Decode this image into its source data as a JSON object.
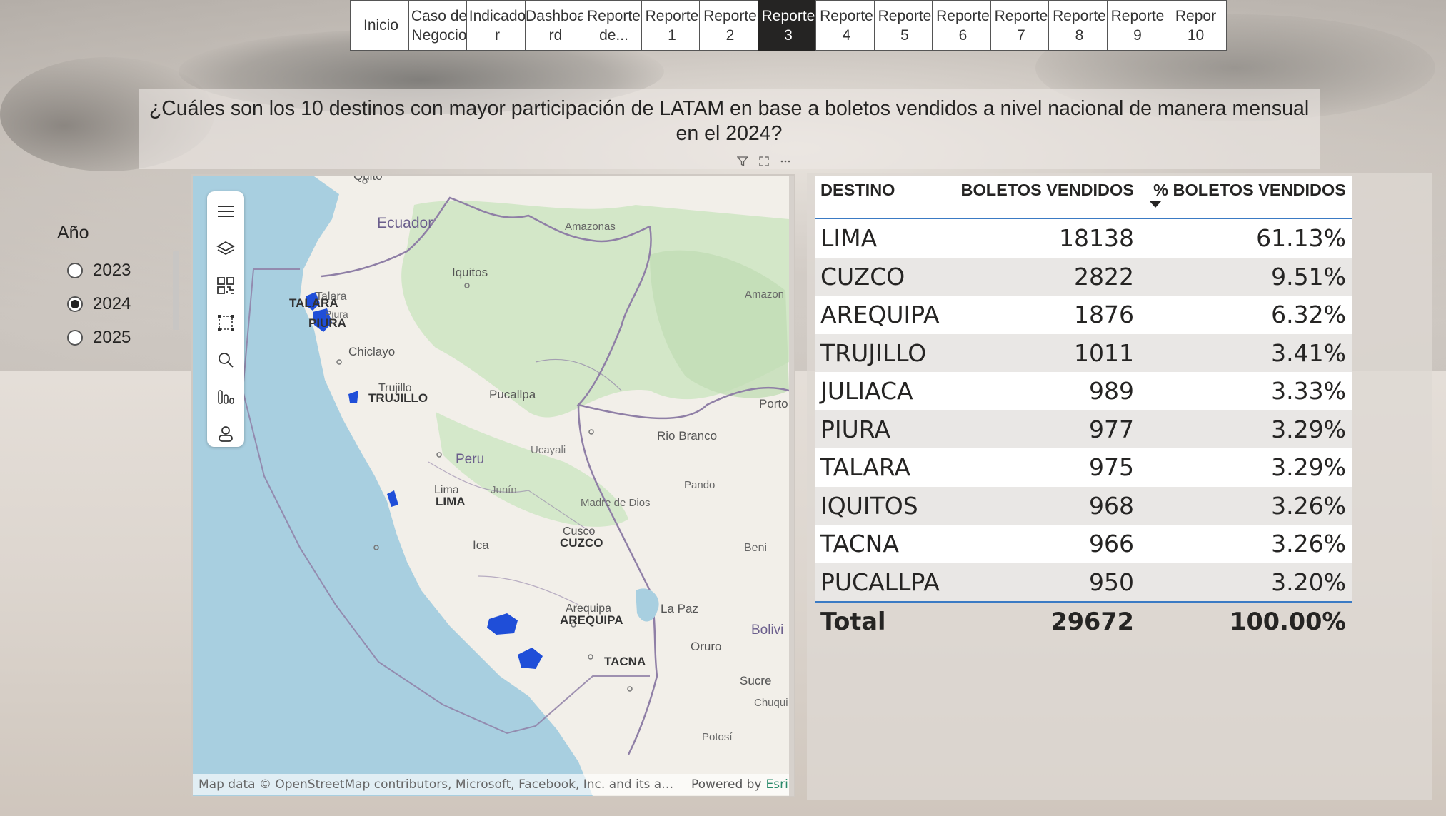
{
  "nav": {
    "buttons": [
      "Inicio",
      "Caso de\nNegocio",
      "Indicado\nr",
      "Dashboa\nrd",
      "Reporte\nde...",
      "Reporte\n1",
      "Reporte\n2",
      "Reporte\n3",
      "Reporte\n4",
      "Reporte\n5",
      "Reporte\n6",
      "Reporte\n7",
      "Reporte\n8",
      "Reporte\n9",
      "Repor\n10"
    ],
    "active_index": 7
  },
  "question": "¿Cuáles son los 10 destinos con mayor participación de LATAM en base a boletos vendidos a nivel nacional de manera mensual en el 2024?",
  "visual_header_icons": [
    "filter-icon",
    "focus-mode-icon",
    "more-options-icon"
  ],
  "slicer": {
    "title": "Año",
    "options": [
      "2023",
      "2024",
      "2025"
    ],
    "selected": "2024"
  },
  "map": {
    "toolbar_icons": [
      "menu-icon",
      "layers-icon",
      "qr-code-icon",
      "select-rectangle-icon",
      "search-icon",
      "analytics-icon",
      "person-icon"
    ],
    "labels": {
      "quito": "Quito",
      "ecuador": "Ecuador",
      "amazonas": "Amazonas",
      "amazon": "Amazon",
      "iquitos": "Iquitos",
      "talara_place": "Talara",
      "talara": "TALARA",
      "piura_place": "Piura",
      "piura": "PIURA",
      "chiclayo": "Chiclayo",
      "trujillo_place": "Trujillo",
      "trujillo": "TRUJILLO",
      "pucallpa": "Pucallpa",
      "porto": "Porto",
      "rio_branco": "Rio Branco",
      "ucayali": "Ucayali",
      "peru": "Peru",
      "pando": "Pando",
      "lima_place": "Lima",
      "lima": "LIMA",
      "junin": "Junín",
      "madre_de_dios": "Madre de Dios",
      "cusco_place": "Cusco",
      "cuzco": "CUZCO",
      "ica": "Ica",
      "beni": "Beni",
      "arequipa_place": "Arequipa",
      "arequipa": "AREQUIPA",
      "la_paz": "La Paz",
      "bolivia": "Bolivi",
      "tacna": "TACNA",
      "oruro": "Oruro",
      "sucre": "Sucre",
      "chuqui": "Chuqui",
      "potosi": "Potosí"
    },
    "attribution": "Map data © OpenStreetMap contributors, Microsoft, Facebook, Inc. and its affiliates",
    "powered_by": "Powered by",
    "esri": "Esri",
    "colors": {
      "water": "#a8cfe0",
      "land": "#f2efe9",
      "forest": "#cfe6c4",
      "border": "#8f7fa6",
      "marker": "#1f4ed8"
    }
  },
  "table": {
    "headers": [
      "DESTINO",
      "BOLETOS VENDIDOS",
      "% BOLETOS VENDIDOS"
    ],
    "rows": [
      [
        "LIMA",
        "18138",
        "61.13%"
      ],
      [
        "CUZCO",
        "2822",
        "9.51%"
      ],
      [
        "AREQUIPA",
        "1876",
        "6.32%"
      ],
      [
        "TRUJILLO",
        "1011",
        "3.41%"
      ],
      [
        "JULIACA",
        "989",
        "3.33%"
      ],
      [
        "PIURA",
        "977",
        "3.29%"
      ],
      [
        "TALARA",
        "975",
        "3.29%"
      ],
      [
        "IQUITOS",
        "968",
        "3.26%"
      ],
      [
        "TACNA",
        "966",
        "3.26%"
      ],
      [
        "PUCALLPA",
        "950",
        "3.20%"
      ]
    ],
    "total": [
      "Total",
      "29672",
      "100.00%"
    ]
  }
}
